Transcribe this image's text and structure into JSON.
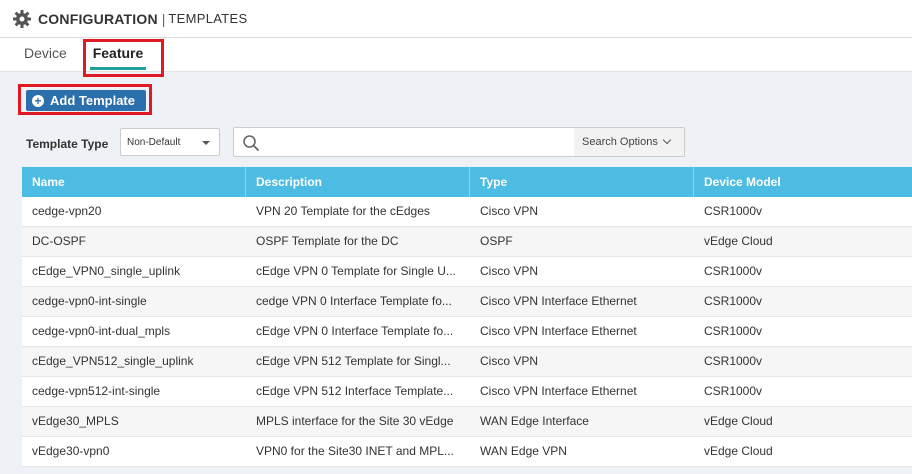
{
  "header": {
    "title": "CONFIGURATION",
    "separator": "|",
    "subtitle": "TEMPLATES",
    "icon": "gear-icon"
  },
  "tabs": [
    {
      "label": "Device",
      "active": false
    },
    {
      "label": "Feature",
      "active": true
    }
  ],
  "colors": {
    "accent": "#1fa29b",
    "button": "#2c6fad",
    "table_header": "#4cbce2",
    "highlight": "#e01a22"
  },
  "toolbar": {
    "add_label": "Add Template"
  },
  "filter": {
    "label": "Template Type",
    "value": "Non-Default"
  },
  "search": {
    "placeholder": "",
    "options_label": "Search Options"
  },
  "table": {
    "columns": [
      "Name",
      "Description",
      "Type",
      "Device Model"
    ],
    "rows": [
      [
        "cedge-vpn20",
        "VPN 20 Template for the cEdges",
        "Cisco VPN",
        "CSR1000v"
      ],
      [
        "DC-OSPF",
        "OSPF Template for the DC",
        "OSPF",
        "vEdge Cloud"
      ],
      [
        "cEdge_VPN0_single_uplink",
        "cEdge VPN 0 Template for Single U...",
        "Cisco VPN",
        "CSR1000v"
      ],
      [
        "cedge-vpn0-int-single",
        "cedge VPN 0 Interface Template fo...",
        "Cisco VPN Interface Ethernet",
        "CSR1000v"
      ],
      [
        "cedge-vpn0-int-dual_mpls",
        "cEdge VPN 0 Interface Template fo...",
        "Cisco VPN Interface Ethernet",
        "CSR1000v"
      ],
      [
        "cEdge_VPN512_single_uplink",
        "cEdge VPN 512 Template for Singl...",
        "Cisco VPN",
        "CSR1000v"
      ],
      [
        "cedge-vpn512-int-single",
        "cEdge VPN 512 Interface Template...",
        "Cisco VPN Interface Ethernet",
        "CSR1000v"
      ],
      [
        "vEdge30_MPLS",
        "MPLS interface for the Site 30 vEdge",
        "WAN Edge Interface",
        "vEdge Cloud"
      ],
      [
        "vEdge30-vpn0",
        "VPN0 for the Site30 INET and MPL...",
        "WAN Edge VPN",
        "vEdge Cloud"
      ]
    ]
  }
}
